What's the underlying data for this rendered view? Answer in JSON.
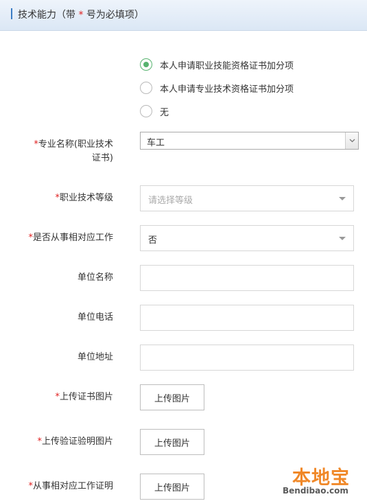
{
  "header": {
    "title_prefix": "技术能力（带 ",
    "title_star": "*",
    "title_suffix": " 号为必填项）"
  },
  "radio_options": [
    {
      "label": "本人申请职业技能资格证书加分项",
      "selected": true
    },
    {
      "label": "本人申请专业技术资格证书加分项",
      "selected": false
    },
    {
      "label": "无",
      "selected": false
    }
  ],
  "form": {
    "major": {
      "star": "*",
      "label_line1": "专业名称(职业技术",
      "label_line2": "证书)",
      "value": "车工"
    },
    "level": {
      "star": "*",
      "label": "职业技术等级",
      "placeholder": "请选择等级"
    },
    "work": {
      "star": "*",
      "label": "是否从事相对应工作",
      "value": "否"
    },
    "company_name": {
      "label": "单位名称",
      "value": ""
    },
    "company_phone": {
      "label": "单位电话",
      "value": ""
    },
    "company_address": {
      "label": "单位地址",
      "value": ""
    },
    "cert_image": {
      "star": "*",
      "label": "上传证书图片",
      "button": "上传图片"
    },
    "verify_image": {
      "star": "*",
      "label": "上传验证验明图片",
      "button": "上传图片"
    },
    "work_proof": {
      "star": "*",
      "label": "从事相对应工作证明",
      "button": "上传图片"
    }
  },
  "watermark": {
    "text": "本地宝",
    "sub": "Bendibao.com"
  },
  "colors": {
    "accent_blue": "#3a7cc4",
    "radio_green": "#57b36f",
    "required_red": "#e02020",
    "watermark_orange": "#f08828"
  }
}
